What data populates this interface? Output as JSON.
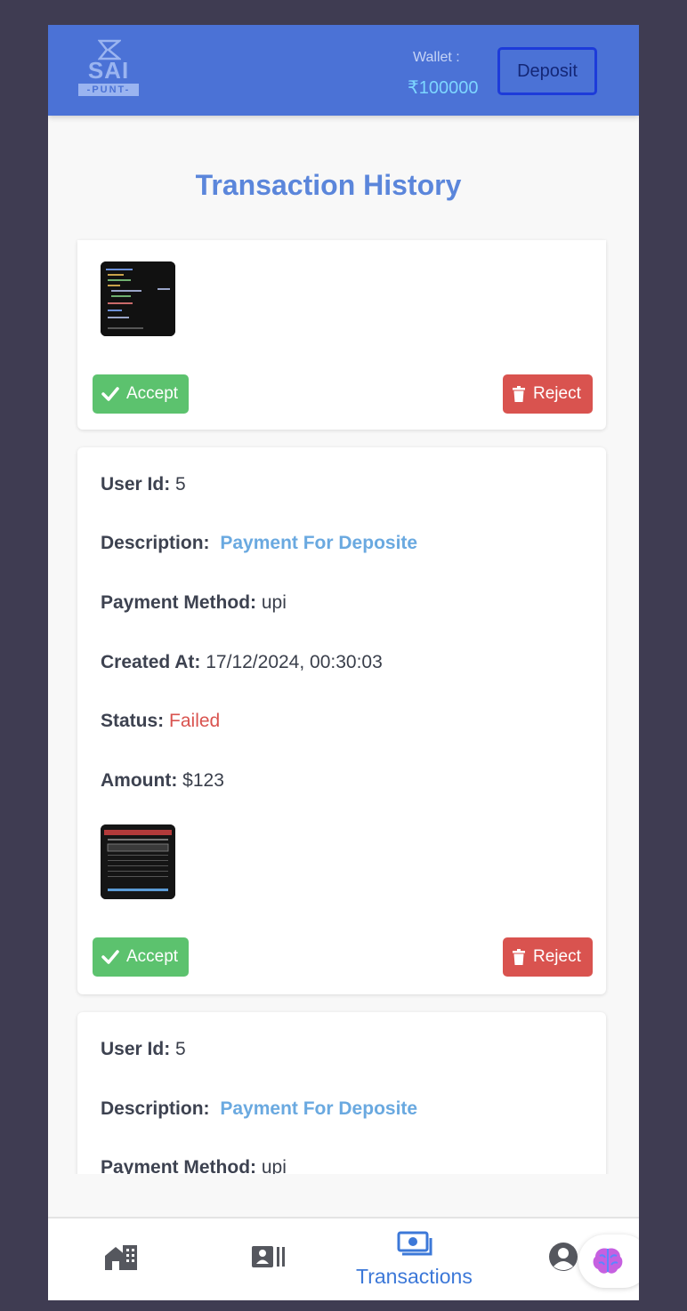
{
  "header": {
    "logo_text": "SAI",
    "logo_sub": "-PUNT-",
    "wallet_label": "Wallet :",
    "wallet_amount": "₹100000",
    "deposit_label": "Deposit"
  },
  "page": {
    "title": "Transaction History"
  },
  "labels": {
    "user_id": "User Id:",
    "description": "Description:",
    "payment_method": "Payment Method:",
    "created_at": "Created At:",
    "status": "Status:",
    "amount": "Amount:",
    "accept": "Accept",
    "reject": "Reject"
  },
  "transactions": [
    {},
    {
      "user_id": "5",
      "description": "Payment For Deposite",
      "payment_method": "upi",
      "created_at": "17/12/2024, 00:30:03",
      "status": "Failed",
      "amount": "$123"
    },
    {
      "user_id": "5",
      "description": "Payment For Deposite",
      "payment_method": "upi"
    }
  ],
  "nav": {
    "active_label": "Transactions",
    "icons": [
      "home-icon",
      "contact-card-icon",
      "money-icon",
      "user-icon",
      "brain-icon"
    ]
  },
  "colors": {
    "header_bg": "#4b72d6",
    "accent": "#5b86db",
    "accept": "#5cc26e",
    "reject": "#d9534f",
    "link": "#6aa9e0",
    "nav_active": "#3c78d8"
  }
}
